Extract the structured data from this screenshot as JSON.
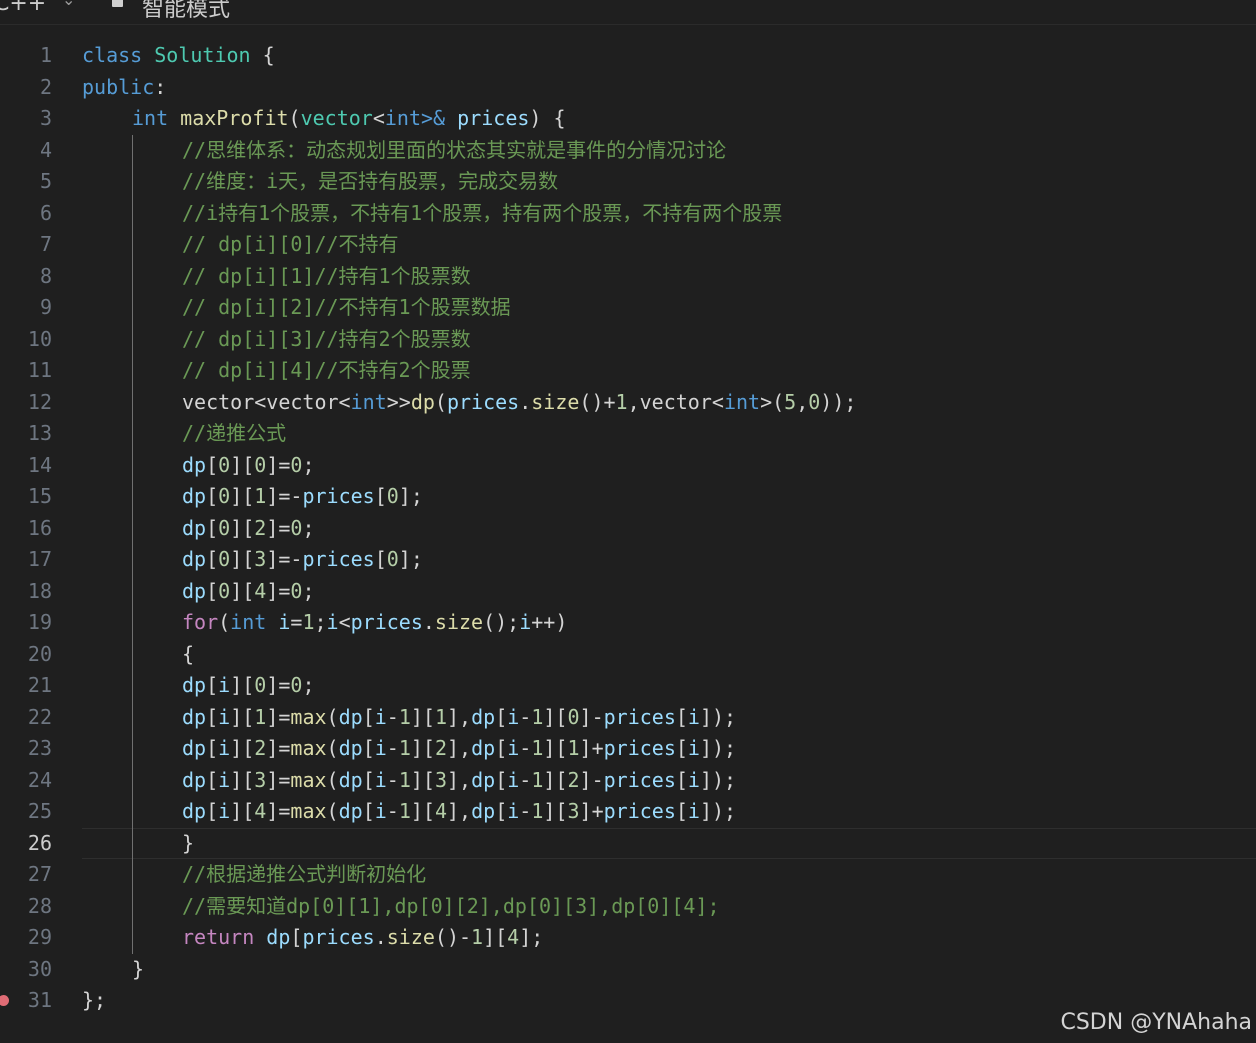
{
  "toolbar": {
    "language": "C++",
    "mode_label": "智能模式"
  },
  "editor": {
    "current_line": 26,
    "breakpoint_line": 31,
    "lines": [
      {
        "n": "1",
        "indent": 0,
        "tokens": [
          [
            "class",
            "kw"
          ],
          [
            " ",
            "text"
          ],
          [
            "Solution",
            "type"
          ],
          [
            " {",
            "punc"
          ]
        ]
      },
      {
        "n": "2",
        "indent": 0,
        "tokens": [
          [
            "public",
            "kw"
          ],
          [
            ":",
            "punc"
          ]
        ]
      },
      {
        "n": "3",
        "indent": 1,
        "tokens": [
          [
            "int",
            "kw"
          ],
          [
            " ",
            "text"
          ],
          [
            "maxProfit",
            "fn"
          ],
          [
            "(",
            "punc"
          ],
          [
            "vector",
            "type"
          ],
          [
            "<",
            "punc"
          ],
          [
            "int",
            "kw"
          ],
          [
            ">&",
            "kw"
          ],
          [
            " ",
            "text"
          ],
          [
            "prices",
            "var"
          ],
          [
            ") {",
            "punc"
          ]
        ]
      },
      {
        "n": "4",
        "indent": 2,
        "tokens": [
          [
            "//思维体系：动态规划里面的状态其实就是事件的分情况讨论",
            "com"
          ]
        ]
      },
      {
        "n": "5",
        "indent": 2,
        "tokens": [
          [
            "//维度：i天，是否持有股票，完成交易数",
            "com"
          ]
        ]
      },
      {
        "n": "6",
        "indent": 2,
        "tokens": [
          [
            "//i持有1个股票，不持有1个股票，持有两个股票，不持有两个股票",
            "com"
          ]
        ]
      },
      {
        "n": "7",
        "indent": 2,
        "tokens": [
          [
            "// dp[i][0]//不持有",
            "com"
          ]
        ]
      },
      {
        "n": "8",
        "indent": 2,
        "tokens": [
          [
            "// dp[i][1]//持有1个股票数",
            "com"
          ]
        ]
      },
      {
        "n": "9",
        "indent": 2,
        "tokens": [
          [
            "// dp[i][2]//不持有1个股票数据",
            "com"
          ]
        ]
      },
      {
        "n": "10",
        "indent": 2,
        "tokens": [
          [
            "// dp[i][3]//持有2个股票数",
            "com"
          ]
        ]
      },
      {
        "n": "11",
        "indent": 2,
        "tokens": [
          [
            "// dp[i][4]//不持有2个股票",
            "com"
          ]
        ]
      },
      {
        "n": "12",
        "indent": 2,
        "tokens": [
          [
            "vector",
            "text"
          ],
          [
            "<",
            "punc"
          ],
          [
            "vector",
            "text"
          ],
          [
            "<",
            "punc"
          ],
          [
            "int",
            "kw"
          ],
          [
            ">>",
            "punc"
          ],
          [
            "dp",
            "fn"
          ],
          [
            "(",
            "punc"
          ],
          [
            "prices",
            "var"
          ],
          [
            ".",
            "punc"
          ],
          [
            "size",
            "fn"
          ],
          [
            "()+",
            "punc"
          ],
          [
            "1",
            "num"
          ],
          [
            ",",
            "punc"
          ],
          [
            "vector",
            "text"
          ],
          [
            "<",
            "punc"
          ],
          [
            "int",
            "kw"
          ],
          [
            ">(",
            "punc"
          ],
          [
            "5",
            "num"
          ],
          [
            ",",
            "punc"
          ],
          [
            "0",
            "num"
          ],
          [
            "));",
            "punc"
          ]
        ]
      },
      {
        "n": "13",
        "indent": 2,
        "tokens": [
          [
            "//递推公式",
            "com"
          ]
        ]
      },
      {
        "n": "14",
        "indent": 2,
        "tokens": [
          [
            "dp",
            "var"
          ],
          [
            "[",
            "punc"
          ],
          [
            "0",
            "num"
          ],
          [
            "][",
            "punc"
          ],
          [
            "0",
            "num"
          ],
          [
            "]=",
            "punc"
          ],
          [
            "0",
            "num"
          ],
          [
            ";",
            "punc"
          ]
        ]
      },
      {
        "n": "15",
        "indent": 2,
        "tokens": [
          [
            "dp",
            "var"
          ],
          [
            "[",
            "punc"
          ],
          [
            "0",
            "num"
          ],
          [
            "][",
            "punc"
          ],
          [
            "1",
            "num"
          ],
          [
            "]=-",
            "punc"
          ],
          [
            "prices",
            "var"
          ],
          [
            "[",
            "punc"
          ],
          [
            "0",
            "num"
          ],
          [
            "];",
            "punc"
          ]
        ]
      },
      {
        "n": "16",
        "indent": 2,
        "tokens": [
          [
            "dp",
            "var"
          ],
          [
            "[",
            "punc"
          ],
          [
            "0",
            "num"
          ],
          [
            "][",
            "punc"
          ],
          [
            "2",
            "num"
          ],
          [
            "]=",
            "punc"
          ],
          [
            "0",
            "num"
          ],
          [
            ";",
            "punc"
          ]
        ]
      },
      {
        "n": "17",
        "indent": 2,
        "tokens": [
          [
            "dp",
            "var"
          ],
          [
            "[",
            "punc"
          ],
          [
            "0",
            "num"
          ],
          [
            "][",
            "punc"
          ],
          [
            "3",
            "num"
          ],
          [
            "]=-",
            "punc"
          ],
          [
            "prices",
            "var"
          ],
          [
            "[",
            "punc"
          ],
          [
            "0",
            "num"
          ],
          [
            "];",
            "punc"
          ]
        ]
      },
      {
        "n": "18",
        "indent": 2,
        "tokens": [
          [
            "dp",
            "var"
          ],
          [
            "[",
            "punc"
          ],
          [
            "0",
            "num"
          ],
          [
            "][",
            "punc"
          ],
          [
            "4",
            "num"
          ],
          [
            "]=",
            "punc"
          ],
          [
            "0",
            "num"
          ],
          [
            ";",
            "punc"
          ]
        ]
      },
      {
        "n": "19",
        "indent": 2,
        "tokens": [
          [
            "for",
            "ctl"
          ],
          [
            "(",
            "punc"
          ],
          [
            "int",
            "kw"
          ],
          [
            " ",
            "text"
          ],
          [
            "i",
            "var"
          ],
          [
            "=",
            "punc"
          ],
          [
            "1",
            "num"
          ],
          [
            ";",
            "punc"
          ],
          [
            "i",
            "var"
          ],
          [
            "<",
            "punc"
          ],
          [
            "prices",
            "var"
          ],
          [
            ".",
            "punc"
          ],
          [
            "size",
            "fn"
          ],
          [
            "();",
            "punc"
          ],
          [
            "i",
            "var"
          ],
          [
            "++)",
            "punc"
          ]
        ]
      },
      {
        "n": "20",
        "indent": 2,
        "tokens": [
          [
            "{",
            "punc"
          ]
        ]
      },
      {
        "n": "21",
        "indent": 2,
        "tokens": [
          [
            "dp",
            "var"
          ],
          [
            "[",
            "punc"
          ],
          [
            "i",
            "var"
          ],
          [
            "][",
            "punc"
          ],
          [
            "0",
            "num"
          ],
          [
            "]=",
            "punc"
          ],
          [
            "0",
            "num"
          ],
          [
            ";",
            "punc"
          ]
        ]
      },
      {
        "n": "22",
        "indent": 2,
        "tokens": [
          [
            "dp",
            "var"
          ],
          [
            "[",
            "punc"
          ],
          [
            "i",
            "var"
          ],
          [
            "][",
            "punc"
          ],
          [
            "1",
            "num"
          ],
          [
            "]=",
            "punc"
          ],
          [
            "max",
            "fn"
          ],
          [
            "(",
            "punc"
          ],
          [
            "dp",
            "var"
          ],
          [
            "[",
            "punc"
          ],
          [
            "i",
            "var"
          ],
          [
            "-",
            "punc"
          ],
          [
            "1",
            "num"
          ],
          [
            "][",
            "punc"
          ],
          [
            "1",
            "num"
          ],
          [
            "],",
            "punc"
          ],
          [
            "dp",
            "var"
          ],
          [
            "[",
            "punc"
          ],
          [
            "i",
            "var"
          ],
          [
            "-",
            "punc"
          ],
          [
            "1",
            "num"
          ],
          [
            "][",
            "punc"
          ],
          [
            "0",
            "num"
          ],
          [
            "]-",
            "punc"
          ],
          [
            "prices",
            "var"
          ],
          [
            "[",
            "punc"
          ],
          [
            "i",
            "var"
          ],
          [
            "]);",
            "punc"
          ]
        ]
      },
      {
        "n": "23",
        "indent": 2,
        "tokens": [
          [
            "dp",
            "var"
          ],
          [
            "[",
            "punc"
          ],
          [
            "i",
            "var"
          ],
          [
            "][",
            "punc"
          ],
          [
            "2",
            "num"
          ],
          [
            "]=",
            "punc"
          ],
          [
            "max",
            "fn"
          ],
          [
            "(",
            "punc"
          ],
          [
            "dp",
            "var"
          ],
          [
            "[",
            "punc"
          ],
          [
            "i",
            "var"
          ],
          [
            "-",
            "punc"
          ],
          [
            "1",
            "num"
          ],
          [
            "][",
            "punc"
          ],
          [
            "2",
            "num"
          ],
          [
            "],",
            "punc"
          ],
          [
            "dp",
            "var"
          ],
          [
            "[",
            "punc"
          ],
          [
            "i",
            "var"
          ],
          [
            "-",
            "punc"
          ],
          [
            "1",
            "num"
          ],
          [
            "][",
            "punc"
          ],
          [
            "1",
            "num"
          ],
          [
            "]+",
            "punc"
          ],
          [
            "prices",
            "var"
          ],
          [
            "[",
            "punc"
          ],
          [
            "i",
            "var"
          ],
          [
            "]);",
            "punc"
          ]
        ]
      },
      {
        "n": "24",
        "indent": 2,
        "tokens": [
          [
            "dp",
            "var"
          ],
          [
            "[",
            "punc"
          ],
          [
            "i",
            "var"
          ],
          [
            "][",
            "punc"
          ],
          [
            "3",
            "num"
          ],
          [
            "]=",
            "punc"
          ],
          [
            "max",
            "fn"
          ],
          [
            "(",
            "punc"
          ],
          [
            "dp",
            "var"
          ],
          [
            "[",
            "punc"
          ],
          [
            "i",
            "var"
          ],
          [
            "-",
            "punc"
          ],
          [
            "1",
            "num"
          ],
          [
            "][",
            "punc"
          ],
          [
            "3",
            "num"
          ],
          [
            "],",
            "punc"
          ],
          [
            "dp",
            "var"
          ],
          [
            "[",
            "punc"
          ],
          [
            "i",
            "var"
          ],
          [
            "-",
            "punc"
          ],
          [
            "1",
            "num"
          ],
          [
            "][",
            "punc"
          ],
          [
            "2",
            "num"
          ],
          [
            "]-",
            "punc"
          ],
          [
            "prices",
            "var"
          ],
          [
            "[",
            "punc"
          ],
          [
            "i",
            "var"
          ],
          [
            "]);",
            "punc"
          ]
        ]
      },
      {
        "n": "25",
        "indent": 2,
        "tokens": [
          [
            "dp",
            "var"
          ],
          [
            "[",
            "punc"
          ],
          [
            "i",
            "var"
          ],
          [
            "][",
            "punc"
          ],
          [
            "4",
            "num"
          ],
          [
            "]=",
            "punc"
          ],
          [
            "max",
            "fn"
          ],
          [
            "(",
            "punc"
          ],
          [
            "dp",
            "var"
          ],
          [
            "[",
            "punc"
          ],
          [
            "i",
            "var"
          ],
          [
            "-",
            "punc"
          ],
          [
            "1",
            "num"
          ],
          [
            "][",
            "punc"
          ],
          [
            "4",
            "num"
          ],
          [
            "],",
            "punc"
          ],
          [
            "dp",
            "var"
          ],
          [
            "[",
            "punc"
          ],
          [
            "i",
            "var"
          ],
          [
            "-",
            "punc"
          ],
          [
            "1",
            "num"
          ],
          [
            "][",
            "punc"
          ],
          [
            "3",
            "num"
          ],
          [
            "]+",
            "punc"
          ],
          [
            "prices",
            "var"
          ],
          [
            "[",
            "punc"
          ],
          [
            "i",
            "var"
          ],
          [
            "]);",
            "punc"
          ]
        ]
      },
      {
        "n": "26",
        "indent": 2,
        "tokens": [
          [
            "}",
            "punc"
          ]
        ]
      },
      {
        "n": "27",
        "indent": 2,
        "tokens": [
          [
            "//根据递推公式判断初始化",
            "com"
          ]
        ]
      },
      {
        "n": "28",
        "indent": 2,
        "tokens": [
          [
            "//需要知道dp[0][1],dp[0][2],dp[0][3],dp[0][4];",
            "com"
          ]
        ]
      },
      {
        "n": "29",
        "indent": 2,
        "tokens": [
          [
            "return",
            "ctl"
          ],
          [
            " ",
            "text"
          ],
          [
            "dp",
            "var"
          ],
          [
            "[",
            "punc"
          ],
          [
            "prices",
            "var"
          ],
          [
            ".",
            "punc"
          ],
          [
            "size",
            "fn"
          ],
          [
            "()-",
            "punc"
          ],
          [
            "1",
            "num"
          ],
          [
            "][",
            "punc"
          ],
          [
            "4",
            "num"
          ],
          [
            "];",
            "punc"
          ]
        ]
      },
      {
        "n": "30",
        "indent": 1,
        "tokens": [
          [
            "}",
            "punc"
          ]
        ]
      },
      {
        "n": "31",
        "indent": 0,
        "tokens": [
          [
            "};",
            "punc"
          ]
        ]
      }
    ]
  },
  "watermark": "CSDN @YNAhaha"
}
